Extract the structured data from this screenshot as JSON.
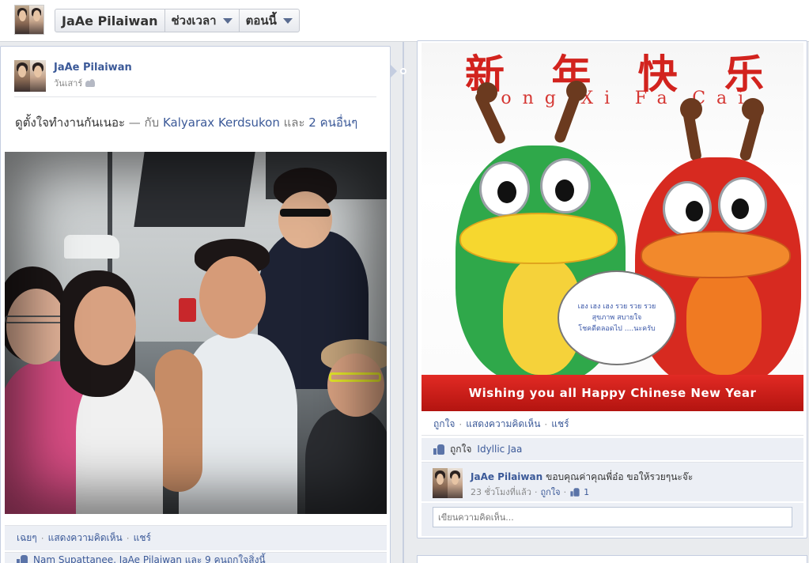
{
  "header": {
    "profile_name": "JaAe Pilaiwan",
    "nav_period": "ช่วงเวลา",
    "nav_now": "ตอนนี้"
  },
  "left_post": {
    "author": "JaAe Pilaiwan",
    "timestamp": "วันเสาร์",
    "text_main": "ดูตั้งใจทำงานกันเนอะ",
    "text_with": " — กับ ",
    "tagged_person": "Kalyarax Kerdsukon",
    "text_and": " และ ",
    "tagged_others": "2 คนอื่นๆ",
    "actions": {
      "like": "เฉยๆ",
      "comment": "แสดงความคิดเห็น",
      "share": "แชร์"
    },
    "likes_line": "Nam Supattanee, JaAe Pilaiwan และ 9 คนถูกใจสิ่งนี้"
  },
  "right_post": {
    "image": {
      "chinese_title": [
        "新",
        "年",
        "快",
        "乐"
      ],
      "pinyin": [
        "Gong",
        "Xi",
        "Fa",
        "Cai"
      ],
      "bubble_text": "เฮง เฮง เฮง รวย รวย รวย\nสุขภาพ สบายใจ\nโชคดีตลอดไป ....นะครับ",
      "banner": "Wishing you all Happy Chinese New Year"
    },
    "actions": {
      "like": "ถูกใจ",
      "comment": "แสดงความคิดเห็น",
      "share": "แชร์"
    },
    "likes_label": "ถูกใจ",
    "likes_person": "Idyllic Jaa",
    "comment": {
      "author": "JaAe Pilaiwan",
      "text": "ขอบคุณค่าคุณพี่อ๋อ ขอให้รวยๆนะจ๊ะ",
      "time": "23 ชั่วโมงที่แล้ว",
      "like": "ถูกใจ",
      "like_count": "1"
    },
    "comment_placeholder": "เขียนความคิดเห็น..."
  },
  "colors": {
    "link": "#3b5998",
    "banner_red": "#d2231e",
    "background": "#e9ebee"
  }
}
